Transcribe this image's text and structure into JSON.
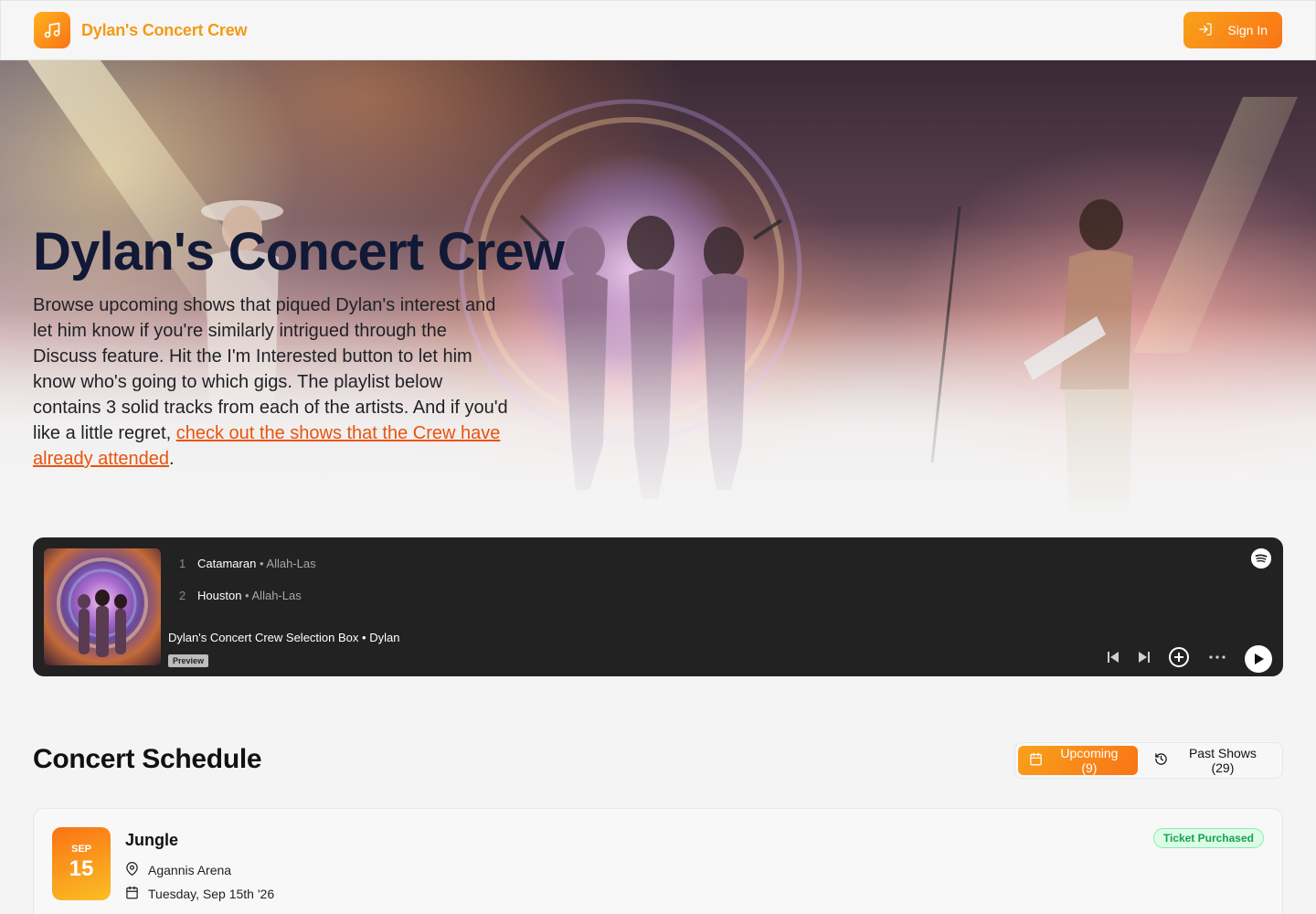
{
  "header": {
    "brand_name": "Dylan's Concert Crew",
    "sign_in_label": "Sign In",
    "logo_icon": "music-note-icon",
    "accent_color": "#f97316"
  },
  "hero": {
    "title": "Dylan's Concert Crew",
    "text_before_link": "Browse upcoming shows that piqued Dylan's interest and let him know if you're similarly intrigued through the Discuss feature. Hit the I'm Interested button to let him know who's going to which gigs. The playlist below contains 3 solid tracks from each of the artists. And if you'd like a little regret, ",
    "link_text": "check out the shows that the Crew have already attended",
    "text_after_link": "."
  },
  "player": {
    "tracks": [
      {
        "number": "1",
        "title": "Catamaran",
        "artist": "Allah-Las"
      },
      {
        "number": "2",
        "title": "Houston",
        "artist": "Allah-Las"
      }
    ],
    "collection_title": "Dylan's Concert Crew Selection Box",
    "collection_owner": "Dylan",
    "separator": "•",
    "preview_label": "Preview"
  },
  "schedule": {
    "title": "Concert Schedule",
    "tabs": [
      {
        "label": "Upcoming (9)",
        "active": true
      },
      {
        "label": "Past Shows (29)",
        "active": false
      }
    ],
    "concerts": [
      {
        "month": "SEP",
        "day": "15",
        "artist": "Jungle",
        "venue": "Agannis Arena",
        "date": "Tuesday, Sep 15th '26",
        "badge": "Ticket Purchased"
      }
    ]
  }
}
